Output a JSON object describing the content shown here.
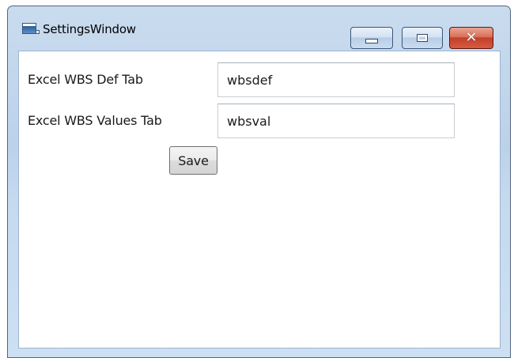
{
  "window": {
    "title": "SettingsWindow",
    "caption_buttons": {
      "minimize_icon": "minimize-icon",
      "maximize_icon": "maximize-icon",
      "close_icon": "close-icon",
      "close_glyph": "✕"
    }
  },
  "form": {
    "fields": [
      {
        "label": "Excel WBS Def Tab",
        "value": "wbsdef"
      },
      {
        "label": "Excel WBS Values Tab",
        "value": "wbsval"
      }
    ],
    "save_label": "Save"
  },
  "colors": {
    "frame_accent": "#bcd2ea",
    "close_button": "#c1402a"
  }
}
